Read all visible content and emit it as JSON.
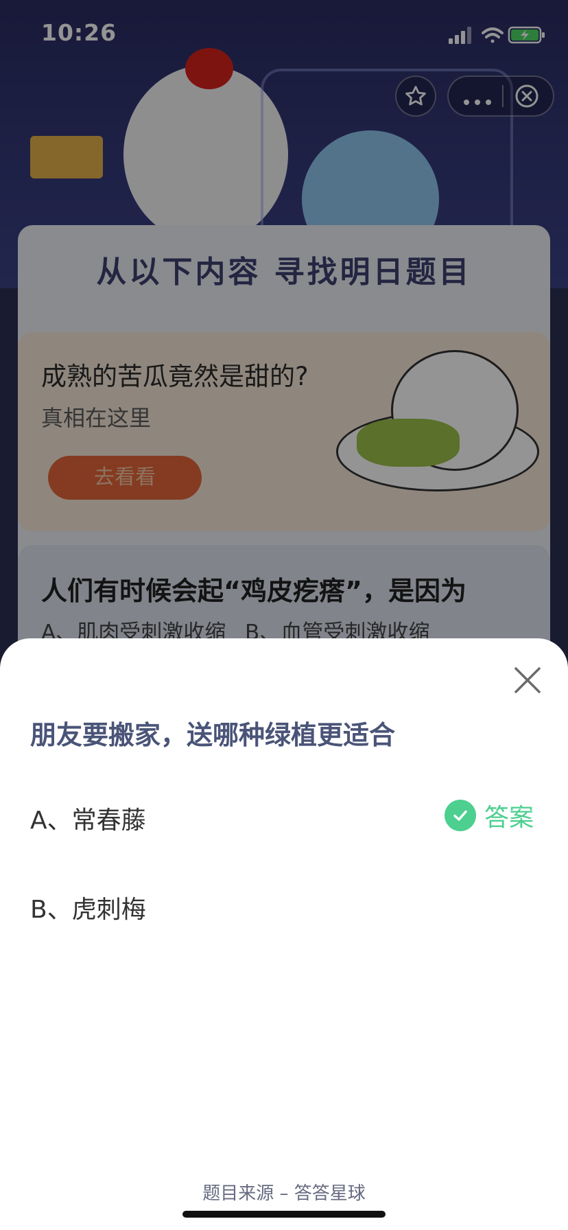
{
  "status_bar": {
    "time": "10:26",
    "icons": [
      "signal-icon",
      "wifi-icon",
      "battery-charging-icon"
    ]
  },
  "capsule": {
    "icons": [
      "star-icon",
      "more-icon",
      "close-circle-icon"
    ]
  },
  "background_page": {
    "section_title": "从以下内容 寻找明日题目",
    "promo": {
      "title": "成熟的苦瓜竟然是甜的?",
      "subtitle": "真相在这里",
      "button": "去看看"
    },
    "question_card": {
      "title": "人们有时候会起“鸡皮疙瘩”，是因为",
      "options": "A、肌肉受刺激收缩 B、血管受刺激收缩"
    }
  },
  "sheet": {
    "question": "朋友要搬家，送哪种绿植更适合",
    "options": [
      {
        "label": "A、常春藤",
        "is_answer": true
      },
      {
        "label": "B、虎刺梅",
        "is_answer": false
      }
    ],
    "answer_label": "答案",
    "source": "题目来源 – 答答星球"
  },
  "colors": {
    "accent_green": "#4ccf8f",
    "promo_button": "#e4673a",
    "question_text": "#4a5478"
  }
}
